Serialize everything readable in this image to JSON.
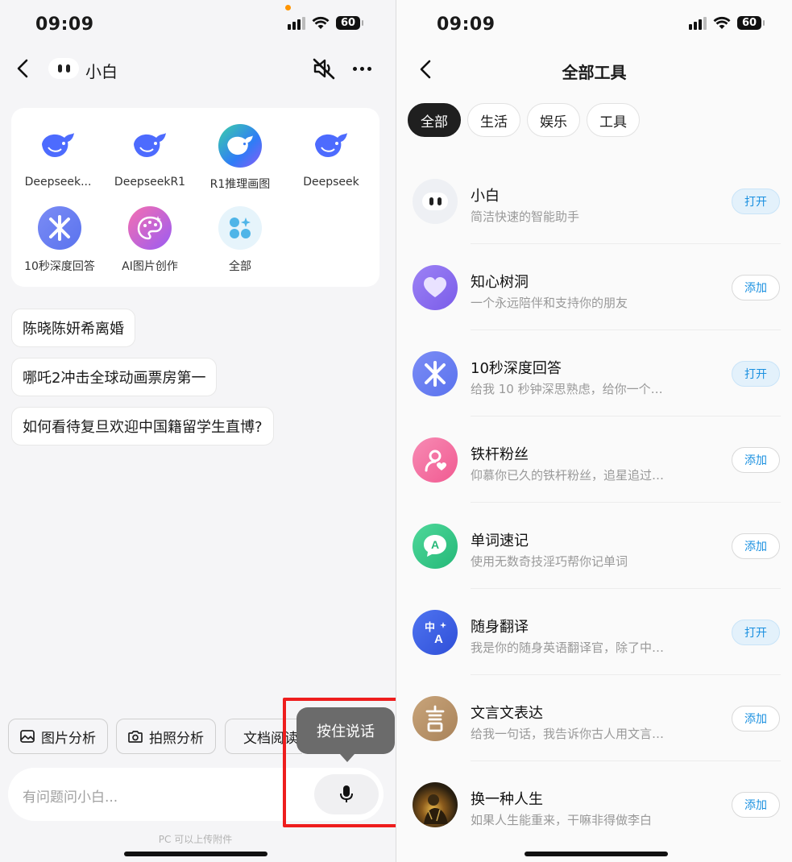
{
  "left": {
    "status": {
      "time": "09:09",
      "battery": "60"
    },
    "header": {
      "title": "小白"
    },
    "tools": [
      {
        "label": "Deepseek...",
        "icon": "deepseek-whale-icon"
      },
      {
        "label": "DeepseekR1",
        "icon": "deepseek-whale-icon"
      },
      {
        "label": "R1推理画图",
        "icon": "deepseek-whale-gradient-icon"
      },
      {
        "label": "Deepseek",
        "icon": "deepseek-whale-icon"
      },
      {
        "label": "10秒深度回答",
        "icon": "star-burst-icon"
      },
      {
        "label": "AI图片创作",
        "icon": "palette-icon"
      },
      {
        "label": "全部",
        "icon": "grid-icon"
      }
    ],
    "suggestions": [
      "陈晓陈妍希离婚",
      "哪吒2冲击全球动画票房第一",
      "如何看待复旦欢迎中国籍留学生直博?"
    ],
    "bottom_tools": {
      "image": "图片分析",
      "photo": "拍照分析",
      "doc": "文档阅读"
    },
    "input": {
      "placeholder": "有问题问小白..."
    },
    "tooltip": "按住说话",
    "hint": "PC 可以上传附件"
  },
  "right": {
    "status": {
      "time": "09:09",
      "battery": "60"
    },
    "title": "全部工具",
    "tabs": [
      "全部",
      "生活",
      "娱乐",
      "工具"
    ],
    "items": [
      {
        "name": "小白",
        "desc": "简洁快速的智能助手",
        "action": "打开",
        "type": "open",
        "icon": "xiaobai-icon",
        "color": "#eef0f4"
      },
      {
        "name": "知心树洞",
        "desc": "一个永远陪伴和支持你的朋友",
        "action": "添加",
        "type": "add",
        "icon": "heart-icon",
        "color": "#8a6cf0"
      },
      {
        "name": "10秒深度回答",
        "desc": "给我 10 秒钟深思熟虑，给你一个…",
        "action": "打开",
        "type": "open",
        "icon": "star-burst-icon",
        "color": "#6a86f2"
      },
      {
        "name": "铁杆粉丝",
        "desc": "仰慕你已久的铁杆粉丝，追星追过…",
        "action": "添加",
        "type": "add",
        "icon": "fan-icon",
        "color": "#f46ca0"
      },
      {
        "name": "单词速记",
        "desc": "使用无数奇技淫巧帮你记单词",
        "action": "添加",
        "type": "add",
        "icon": "letter-a-icon",
        "color": "#36c98a"
      },
      {
        "name": "随身翻译",
        "desc": "我是你的随身英语翻译官，除了中…",
        "action": "打开",
        "type": "open",
        "icon": "translate-icon",
        "color": "#3d63e8"
      },
      {
        "name": "文言文表达",
        "desc": "给我一句话，我告诉你古人用文言…",
        "action": "添加",
        "type": "add",
        "icon": "yan-character-icon",
        "color": "#b8946b"
      },
      {
        "name": "换一种人生",
        "desc": "如果人生能重来，干嘛非得做李白",
        "action": "添加",
        "type": "add",
        "icon": "portrait-icon",
        "color": "#3a2a12"
      }
    ]
  }
}
